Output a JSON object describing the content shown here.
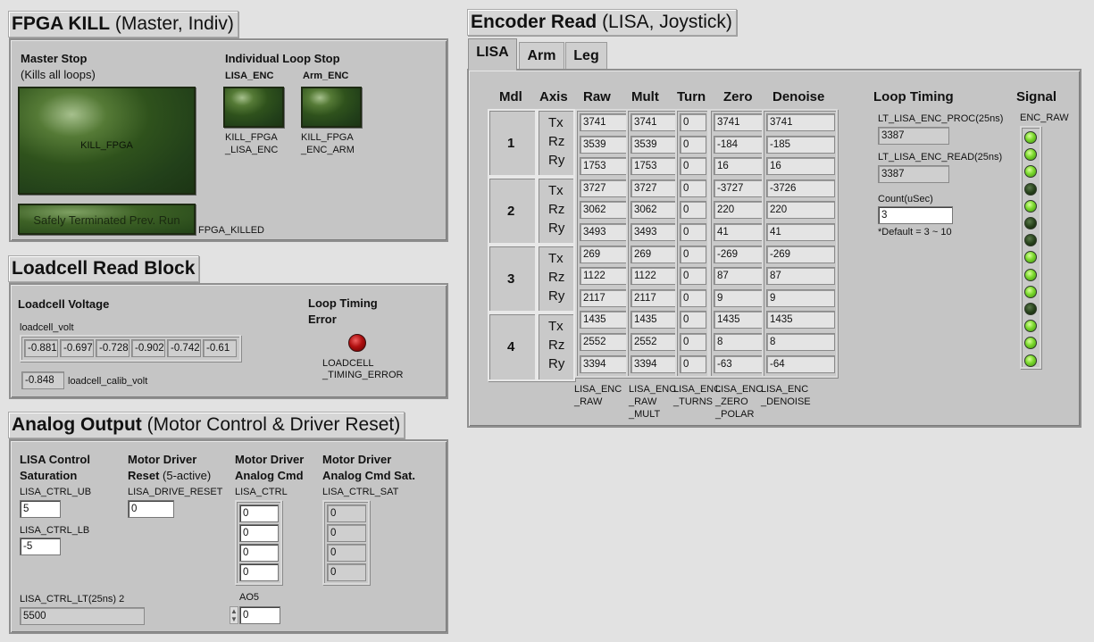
{
  "fpga_kill": {
    "title_bold": "FPGA KILL",
    "title_rest": "(Master, Indiv)",
    "master_stop": "Master Stop",
    "master_note": "(Kills all loops)",
    "kill_fpga_label": "KILL_FPGA",
    "safely_label": "Safely Terminated Prev. Run",
    "fpga_killed": "FPGA_KILLED",
    "indiv_title": "Individual Loop Stop",
    "lisa_enc": "LISA_ENC",
    "arm_enc": "Arm_ENC",
    "kill_lisa_1": "KILL_FPGA",
    "kill_lisa_2": "_LISA_ENC",
    "kill_arm_1": "KILL_FPGA",
    "kill_arm_2": "_ENC_ARM"
  },
  "loadcell": {
    "title": "Loadcell Read Block",
    "voltage_label": "Loadcell Voltage",
    "volt_name": "loadcell_volt",
    "volts": [
      "-0.881",
      "-0.697",
      "-0.728",
      "-0.902",
      "-0.742",
      "-0.61"
    ],
    "calib_value": "-0.848",
    "calib_name": "loadcell_calib_volt",
    "loop_timing": "Loop Timing",
    "error": "Error",
    "err_name_1": "LOADCELL",
    "err_name_2": "_TIMING_ERROR"
  },
  "analog": {
    "title_bold": "Analog Output",
    "title_rest": "(Motor Control & Driver Reset)",
    "lisa_ctrl_1": "LISA Control",
    "lisa_ctrl_2": "Saturation",
    "ub_name": "LISA_CTRL_UB",
    "ub_value": "5",
    "lb_name": "LISA_CTRL_LB",
    "lb_value": "-5",
    "lt_name": "LISA_CTRL_LT(25ns) 2",
    "lt_value": "5500",
    "mdr_1": "Motor Driver",
    "mdr_2": "Reset",
    "mdr_2b": "(5-active)",
    "reset_name": "LISA_DRIVE_RESET",
    "reset_value": "0",
    "mda_1": "Motor Driver",
    "mda_2": "Analog Cmd",
    "ctrl_name": "LISA_CTRL",
    "ctrl_values": [
      "0",
      "0",
      "0",
      "0"
    ],
    "ao5_name": "AO5",
    "ao5_value": "0",
    "sat_1": "Motor Driver",
    "sat_2": "Analog Cmd Sat.",
    "sat_name": "LISA_CTRL_SAT",
    "sat_values": [
      "0",
      "0",
      "0",
      "0"
    ]
  },
  "encoder": {
    "title_bold": "Encoder Read",
    "title_rest": "(LISA, Joystick)",
    "tabs": [
      "LISA",
      "Arm",
      "Leg"
    ],
    "headers": {
      "mdl": "Mdl",
      "axis": "Axis",
      "raw": "Raw",
      "mult": "Mult",
      "turn": "Turn",
      "zero": "Zero",
      "denoise": "Denoise"
    },
    "modules": [
      "1",
      "2",
      "3",
      "4"
    ],
    "axes": [
      "Tx",
      "Rz",
      "Ry"
    ],
    "raw": [
      "3741",
      "3539",
      "1753",
      "3727",
      "3062",
      "3493",
      "269",
      "1122",
      "2117",
      "1435",
      "2552",
      "3394"
    ],
    "mult": [
      "3741",
      "3539",
      "1753",
      "3727",
      "3062",
      "3493",
      "269",
      "1122",
      "2117",
      "1435",
      "2552",
      "3394"
    ],
    "turn": [
      "0",
      "0",
      "0",
      "0",
      "0",
      "0",
      "0",
      "0",
      "0",
      "0",
      "0",
      "0"
    ],
    "zero": [
      "3741",
      "-184",
      "16",
      "-3727",
      "220",
      "41",
      "-269",
      "87",
      "9",
      "1435",
      "8",
      "-63"
    ],
    "denoise": [
      "3741",
      "-185",
      "16",
      "-3726",
      "220",
      "41",
      "-269",
      "87",
      "9",
      "1435",
      "8",
      "-64"
    ],
    "col_names": {
      "raw": [
        "LISA_ENC",
        "_RAW"
      ],
      "mult": [
        "LISA_ENC",
        "_RAW",
        "_MULT"
      ],
      "turn": [
        "LISA_ENC",
        "_TURNS"
      ],
      "zero": [
        "LISA_ENC",
        "_ZERO",
        "_POLAR"
      ],
      "denoise": [
        "LISA_ENC",
        "_DENOISE"
      ]
    },
    "loop_timing": "Loop Timing",
    "proc_name": "LT_LISA_ENC_PROC(25ns)",
    "proc_value": "3387",
    "read_name": "LT_LISA_ENC_READ(25ns)",
    "read_value": "3387",
    "count_name": "Count(uSec)",
    "count_value": "3",
    "count_default": "*Default = 3 ~ 10",
    "signal": "Signal",
    "signal_name": "ENC_RAW",
    "leds": [
      true,
      true,
      true,
      false,
      true,
      false,
      false,
      true,
      true,
      true,
      false,
      true,
      true,
      true
    ]
  }
}
